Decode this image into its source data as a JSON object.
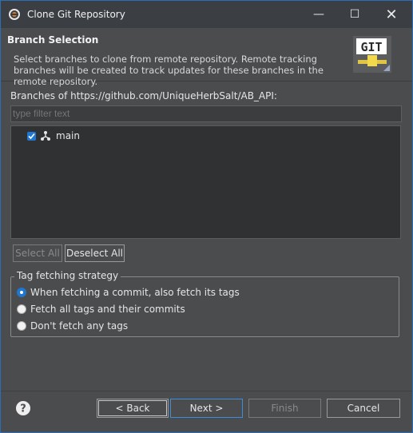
{
  "window": {
    "title": "Clone Git Repository",
    "controls": {
      "minimize": "—",
      "maximize": "☐",
      "close": "✕"
    }
  },
  "header": {
    "title": "Branch Selection",
    "description": "Select branches to clone from remote repository. Remote tracking branches will be created to track updates for these branches in the remote repository.",
    "logo_text": "GIT"
  },
  "branches": {
    "label": "Branches of https://github.com/UniqueHerbSalt/AB_API:",
    "filter_placeholder": "type filter text",
    "items": [
      {
        "name": "main",
        "checked": true
      }
    ]
  },
  "selection_buttons": {
    "select_all": "Select All",
    "deselect_all": "Deselect All"
  },
  "tag_strategy": {
    "legend": "Tag fetching strategy",
    "options": [
      {
        "label": "When fetching a commit, also fetch its tags",
        "checked": true
      },
      {
        "label": "Fetch all tags and their commits",
        "checked": false
      },
      {
        "label": "Don't fetch any tags",
        "checked": false
      }
    ]
  },
  "footer": {
    "back": "< Back",
    "next": "Next >",
    "finish": "Finish",
    "cancel": "Cancel",
    "help_icon": "question-mark"
  },
  "colors": {
    "accent": "#1f77d0",
    "window_bg": "#4a4c4e",
    "titlebar_bg": "#3b3f44"
  }
}
